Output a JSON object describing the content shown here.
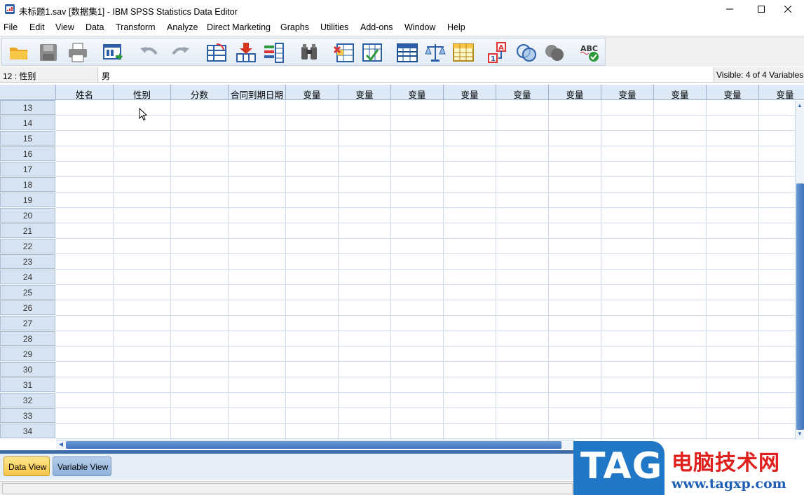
{
  "window": {
    "title": "未标题1.sav [数据集1] - IBM SPSS Statistics Data Editor",
    "minimize_icon": "minimize-icon",
    "maximize_icon": "maximize-icon",
    "close_icon": "close-icon"
  },
  "menu": [
    {
      "label": "File"
    },
    {
      "label": "Edit"
    },
    {
      "label": "View"
    },
    {
      "label": "Data"
    },
    {
      "label": "Transform"
    },
    {
      "label": "Analyze"
    },
    {
      "label": "Direct Marketing"
    },
    {
      "label": "Graphs"
    },
    {
      "label": "Utilities"
    },
    {
      "label": "Add-ons"
    },
    {
      "label": "Window"
    },
    {
      "label": "Help"
    }
  ],
  "toolbar": [
    "open-folder-icon",
    "save-icon",
    "print-icon",
    "dialog-recall-icon",
    "undo-icon",
    "redo-icon",
    "goto-case-icon",
    "goto-variable-icon",
    "variables-icon",
    "find-icon",
    "insert-cases-icon",
    "insert-variable-icon",
    "split-file-icon",
    "weight-cases-icon",
    "select-cases-icon",
    "value-labels-icon",
    "use-sets-icon",
    "show-all-variables-icon",
    "spell-check-icon"
  ],
  "cell_editor": {
    "reference": "12 : 性别",
    "value": "男",
    "visible": "Visible: 4 of 4 Variables"
  },
  "grid": {
    "columns": [
      "姓名",
      "性别",
      "分数",
      "合同到期日期",
      "变量",
      "变量",
      "变量",
      "变量",
      "变量",
      "变量",
      "变量",
      "变量",
      "变量",
      "变量"
    ],
    "rows": [
      "13",
      "14",
      "15",
      "16",
      "17",
      "18",
      "19",
      "20",
      "21",
      "22",
      "23",
      "24",
      "25",
      "26",
      "27",
      "28",
      "29",
      "30",
      "31",
      "32",
      "33",
      "34"
    ]
  },
  "tabs": {
    "data_view": "Data View",
    "variable_view": "Variable View"
  },
  "watermark": {
    "tag": "TAG",
    "cn": "电脑技术网",
    "url": "www.tagxp.com"
  },
  "colors": {
    "accent": "#3e6eaa",
    "column_header": "#dde9f6",
    "active_tab": "#f7c64a"
  }
}
